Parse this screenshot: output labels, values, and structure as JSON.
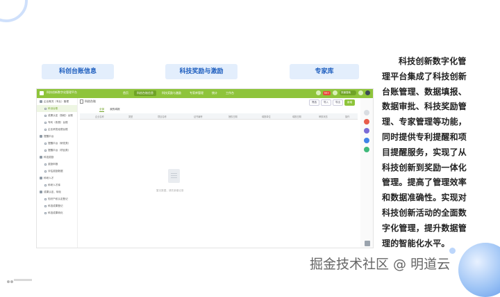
{
  "tags": {
    "t1": "科创台账信息",
    "t2": "科技奖励与激励",
    "t3": "专家库"
  },
  "app": {
    "title": "科技创新数字化管理平台",
    "nav": [
      "首页",
      "科创台账信息",
      "科技奖励与激励",
      "专家库管理",
      "统计",
      "工作台"
    ],
    "badge": "99+",
    "search": "快速搜索"
  },
  "sidebar": {
    "items": [
      {
        "label": "企业概况（专业）管理",
        "kind": "group"
      },
      {
        "label": "科创台账",
        "kind": "sub",
        "active": true
      },
      {
        "label": "成果认定（授权）台账",
        "kind": "sub"
      },
      {
        "label": "专利（收费）台账",
        "kind": "sub"
      },
      {
        "label": "企业研发经费台账",
        "kind": "sub"
      },
      {
        "label": "提醒平台",
        "kind": "group"
      },
      {
        "label": "提醒平台（研发类）",
        "kind": "sub"
      },
      {
        "label": "提醒平台（项目类）",
        "kind": "sub"
      },
      {
        "label": "科技奖励",
        "kind": "group"
      },
      {
        "label": "奖励申报",
        "kind": "sub"
      },
      {
        "label": "评估奖励数据",
        "kind": "sub"
      },
      {
        "label": "科研人才",
        "kind": "group"
      },
      {
        "label": "科研人才库",
        "kind": "sub"
      },
      {
        "label": "成果认定、转化",
        "kind": "group"
      },
      {
        "label": "知识产权认定登记",
        "kind": "sub"
      },
      {
        "label": "科技成果登记",
        "kind": "sub"
      },
      {
        "label": "科技成果转化",
        "kind": "sub"
      }
    ]
  },
  "main": {
    "tab": "科创台账",
    "filters": [
      "筛选",
      "导入",
      "导出",
      "新增"
    ],
    "subtabs": [
      "全部",
      "我的填报"
    ],
    "columns": [
      "企业名称",
      "类型",
      "项目名称",
      "证书编号",
      "授权日期",
      "填报单位",
      "填报日期",
      "审核状态",
      "操作"
    ],
    "empty_text": "暂无数据，请先新增记录"
  },
  "description": "科技创新数字化管理平台集成了科技创新台账管理、数据填报、数据审批、科技奖励管理、专家管理等功能，同时提供专利提醒和项目提醒服务，实现了从科技创新到奖励一体化管理。提高了管理效率和数据准确性。实现对科技创新活动的全面数字化管理，提升数据管理的智能化水平。",
  "watermark": "掘金技术社区 @ 明道云",
  "colors": {
    "accent": "#8ec43b",
    "tag_bg": "#e3eefc",
    "tag_text": "#1f5fbf"
  }
}
